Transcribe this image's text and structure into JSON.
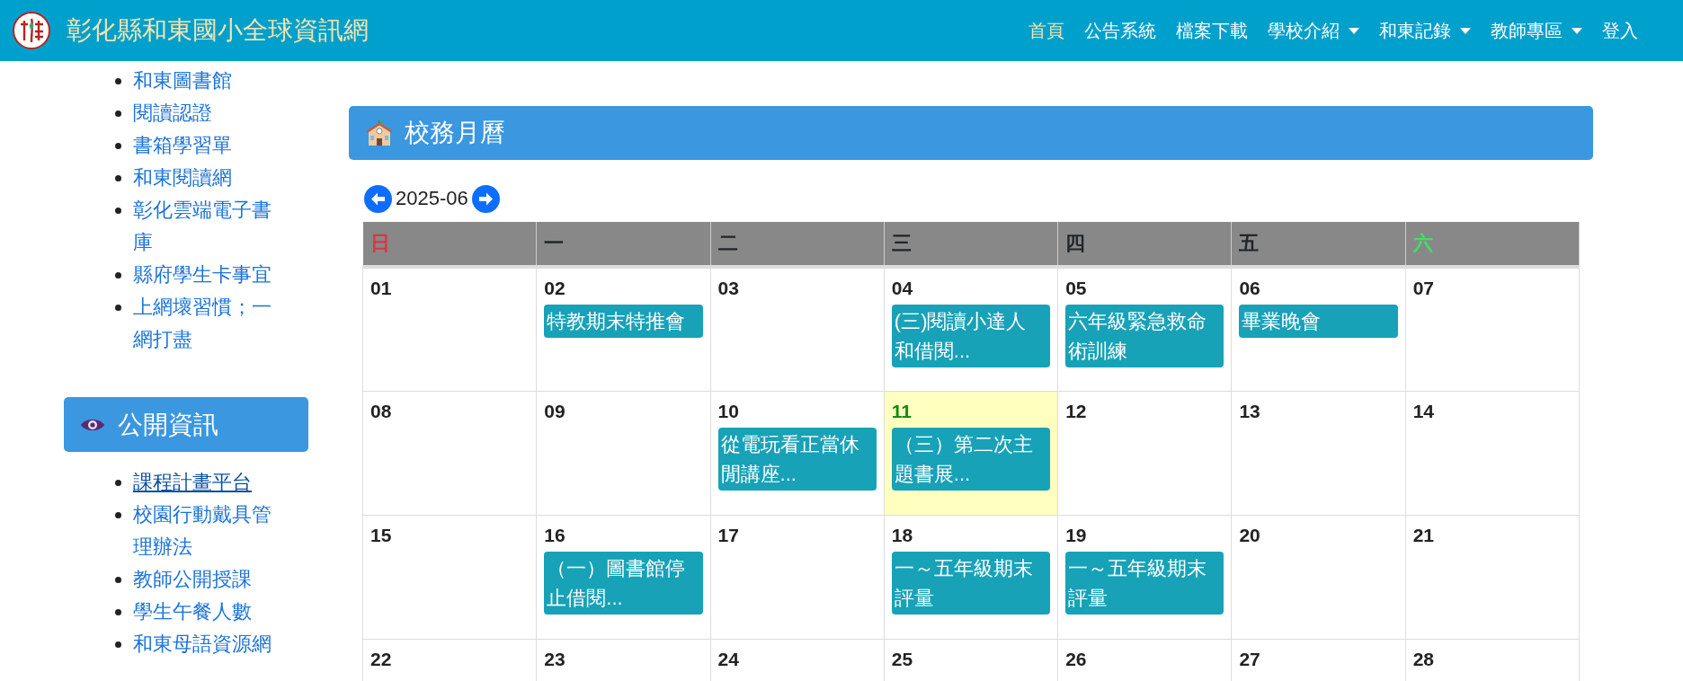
{
  "header": {
    "title": "彰化縣和東國小全球資訊網",
    "nav": [
      {
        "label": "首頁",
        "selected": true,
        "dropdown": false
      },
      {
        "label": "公告系統",
        "selected": false,
        "dropdown": false
      },
      {
        "label": "檔案下載",
        "selected": false,
        "dropdown": false
      },
      {
        "label": "學校介紹",
        "selected": false,
        "dropdown": true
      },
      {
        "label": "和東記錄",
        "selected": false,
        "dropdown": true
      },
      {
        "label": "教師專區",
        "selected": false,
        "dropdown": true
      },
      {
        "label": "登入",
        "selected": false,
        "dropdown": false
      }
    ]
  },
  "sidebar": {
    "links": [
      {
        "label": "和東圖書館",
        "hovered": false
      },
      {
        "label": "閱讀認證",
        "hovered": false
      },
      {
        "label": "書箱學習單",
        "hovered": false
      },
      {
        "label": "和東閱讀網",
        "hovered": false
      },
      {
        "label": "彰化雲端電子書庫",
        "hovered": false
      },
      {
        "label": "縣府學生卡事宜",
        "hovered": false
      },
      {
        "label": "上網壞習慣；一網打盡",
        "hovered": false
      }
    ],
    "section": {
      "title": "公開資訊",
      "links": [
        {
          "label": "課程計畫平台",
          "hovered": true
        },
        {
          "label": "校園行動戴具管理辦法",
          "hovered": false
        },
        {
          "label": "教師公開授課",
          "hovered": false
        },
        {
          "label": "學生午餐人數",
          "hovered": false
        },
        {
          "label": "和東母語資源網",
          "hovered": false
        }
      ]
    }
  },
  "calendar": {
    "title": "校務月曆",
    "month": "2025-06",
    "weekdays": [
      {
        "label": "日",
        "color": "#dc3545"
      },
      {
        "label": "一",
        "color": "#212529"
      },
      {
        "label": "二",
        "color": "#212529"
      },
      {
        "label": "三",
        "color": "#212529"
      },
      {
        "label": "四",
        "color": "#212529"
      },
      {
        "label": "五",
        "color": "#212529"
      },
      {
        "label": "六",
        "color": "#3ee06a"
      }
    ],
    "weeks": [
      {
        "days": [
          {
            "date": "01",
            "today": false
          },
          {
            "date": "02",
            "today": false,
            "events": [
              "特教期末特推會"
            ]
          },
          {
            "date": "03",
            "today": false
          },
          {
            "date": "04",
            "today": false,
            "events": [
              "(三)閱讀小達人和借閱..."
            ]
          },
          {
            "date": "05",
            "today": false,
            "events": [
              "六年級緊急救命術訓練"
            ]
          },
          {
            "date": "06",
            "today": false,
            "events": [
              "畢業晚會"
            ]
          },
          {
            "date": "07",
            "today": false
          }
        ]
      },
      {
        "days": [
          {
            "date": "08",
            "today": false
          },
          {
            "date": "09",
            "today": false
          },
          {
            "date": "10",
            "today": false,
            "events": [
              "從電玩看正當休閒講座..."
            ]
          },
          {
            "date": "11",
            "today": true,
            "events": [
              "（三）第二次主題書展..."
            ]
          },
          {
            "date": "12",
            "today": false
          },
          {
            "date": "13",
            "today": false
          },
          {
            "date": "14",
            "today": false
          }
        ]
      },
      {
        "days": [
          {
            "date": "15",
            "today": false
          },
          {
            "date": "16",
            "today": false,
            "events": [
              "（一）圖書館停止借閱..."
            ]
          },
          {
            "date": "17",
            "today": false
          },
          {
            "date": "18",
            "today": false,
            "events": [
              "一～五年級期末評量"
            ]
          },
          {
            "date": "19",
            "today": false,
            "events": [
              "一～五年級期末評量"
            ]
          },
          {
            "date": "20",
            "today": false
          },
          {
            "date": "21",
            "today": false
          }
        ]
      },
      {
        "days": [
          {
            "date": "22",
            "today": false
          },
          {
            "date": "23",
            "today": false
          },
          {
            "date": "24",
            "today": false
          },
          {
            "date": "25",
            "today": false
          },
          {
            "date": "26",
            "today": false
          },
          {
            "date": "27",
            "today": false
          },
          {
            "date": "28",
            "today": false
          }
        ]
      }
    ]
  }
}
